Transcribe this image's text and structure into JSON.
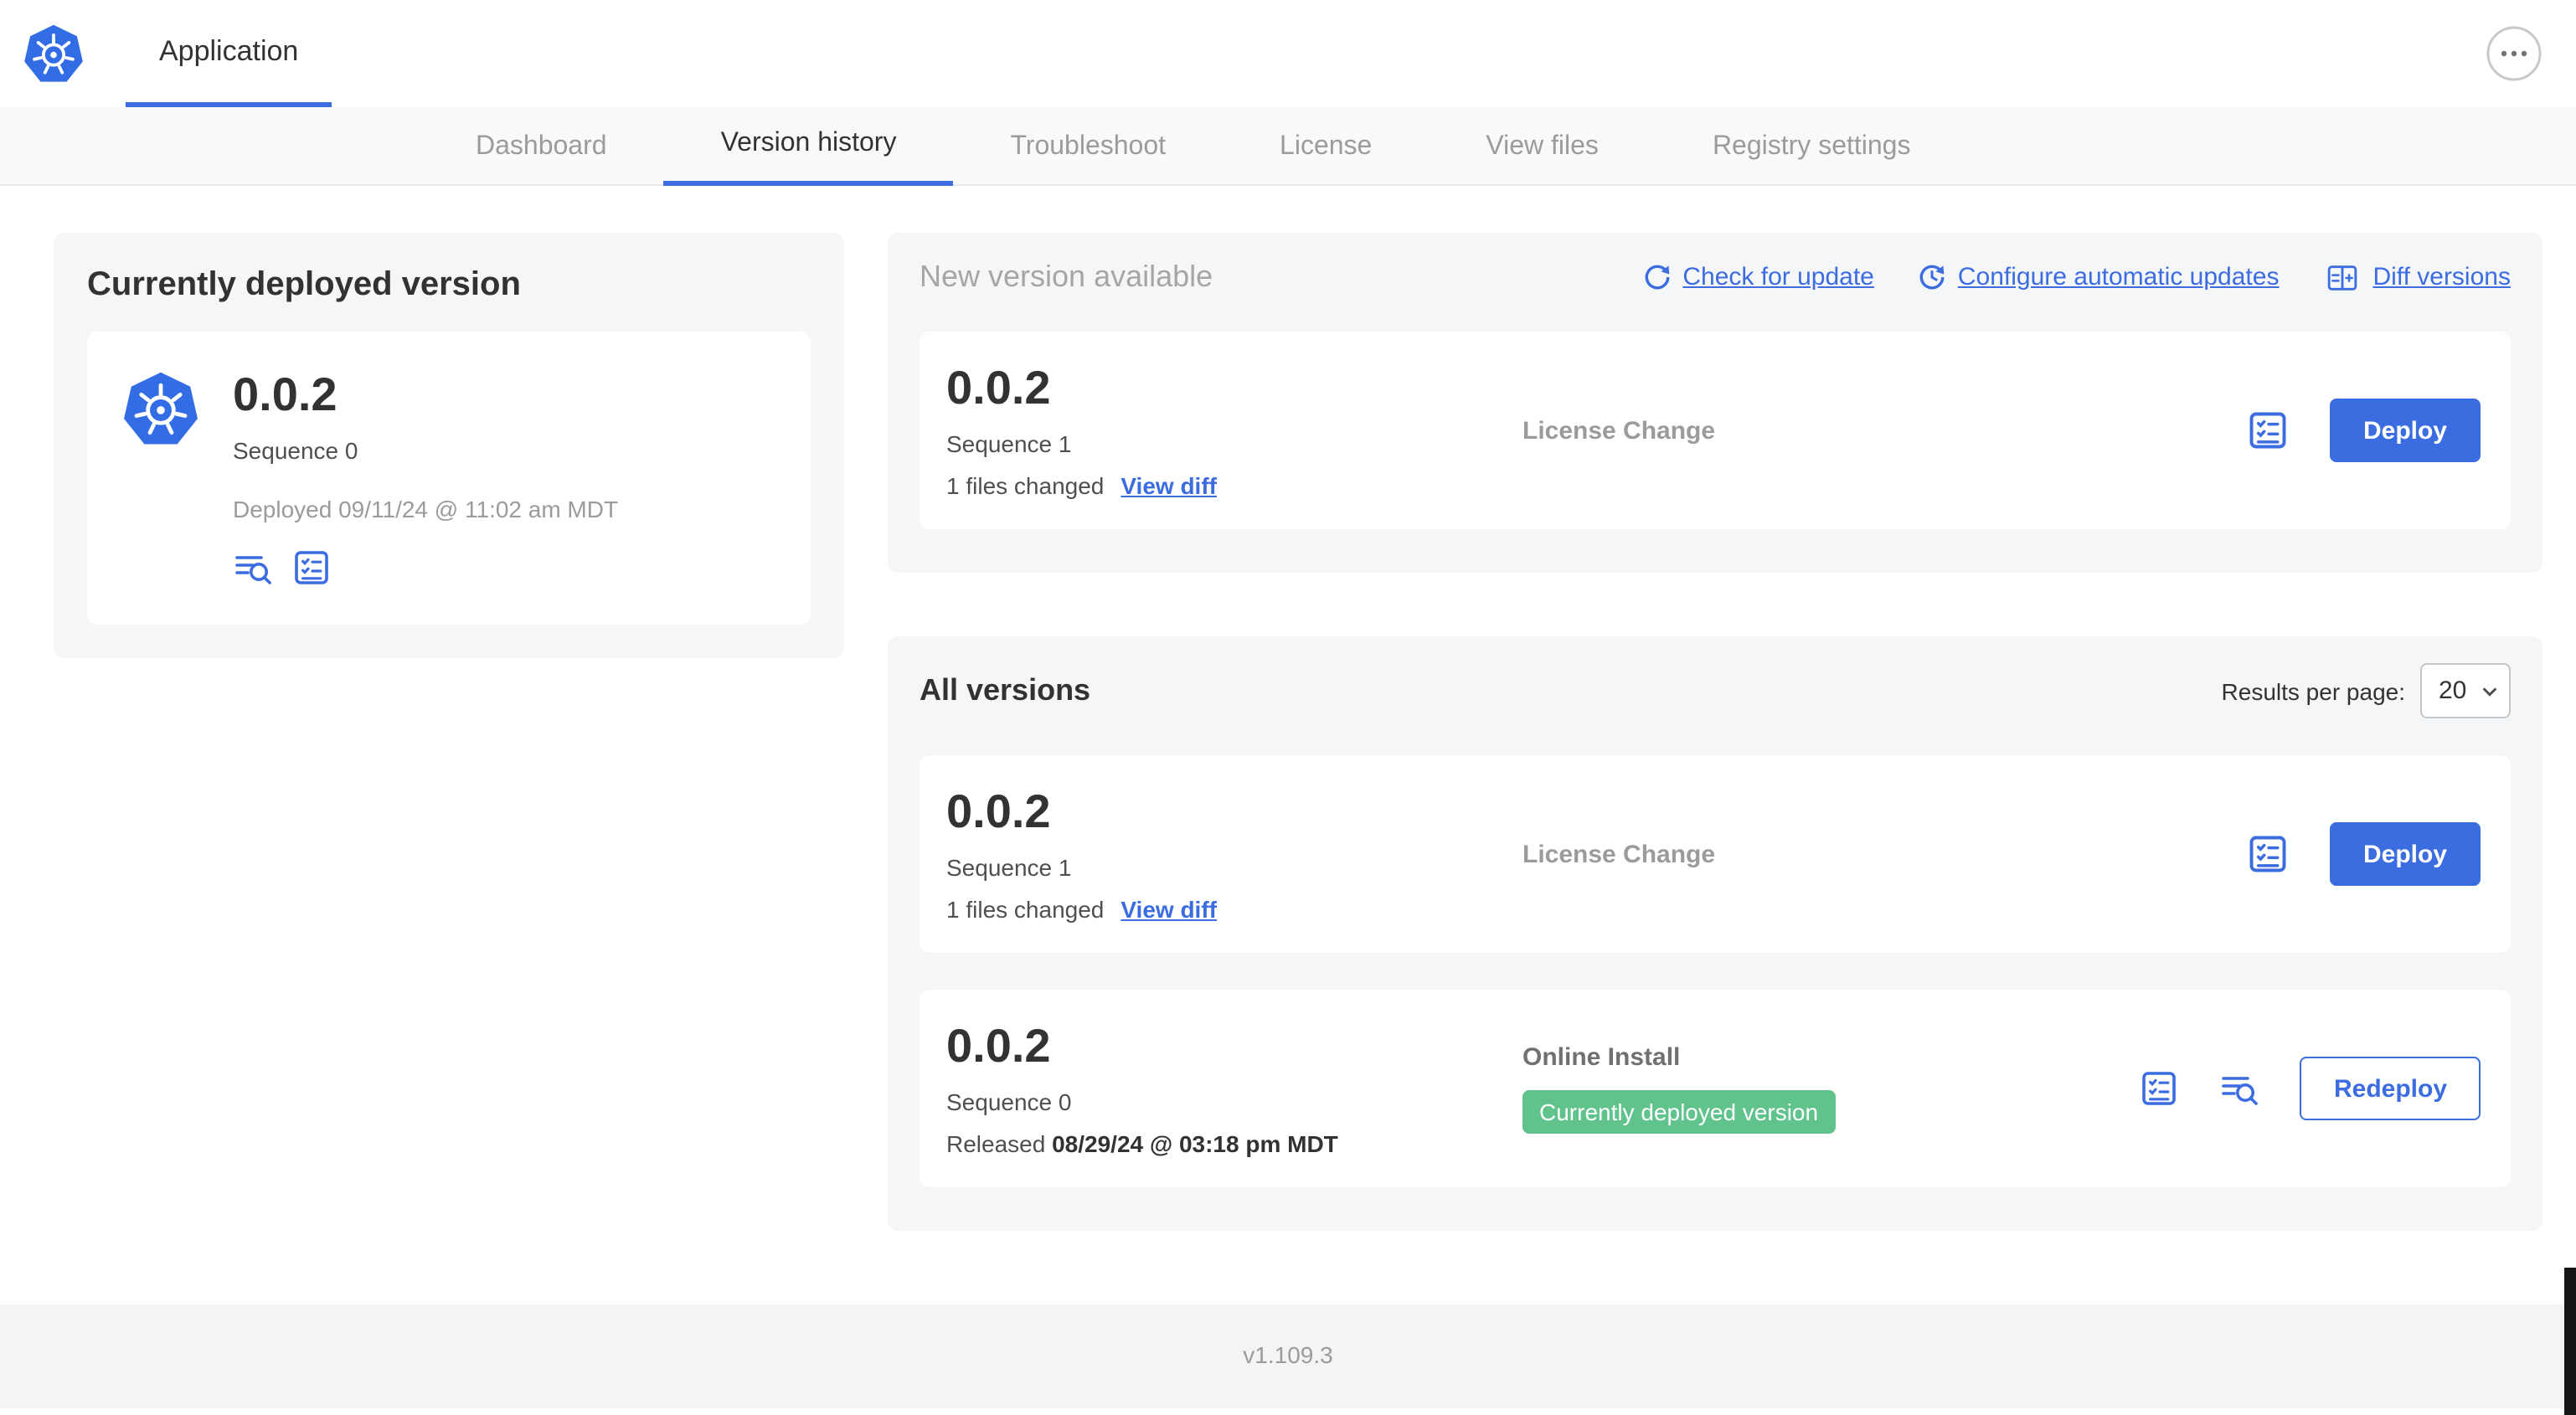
{
  "header": {
    "app_tab": "Application"
  },
  "nav": {
    "tabs": [
      "Dashboard",
      "Version history",
      "Troubleshoot",
      "License",
      "View files",
      "Registry settings"
    ]
  },
  "deployed_panel": {
    "title": "Currently deployed version",
    "version": "0.0.2",
    "sequence": "Sequence 0",
    "deployed_at": "Deployed 09/11/24 @ 11:02 am MDT"
  },
  "new_version_panel": {
    "title": "New version available",
    "check_for_update": "Check for update",
    "configure_updates": "Configure automatic updates",
    "diff_versions": "Diff versions",
    "card": {
      "version": "0.0.2",
      "sequence": "Sequence 1",
      "files_changed": "1 files changed",
      "view_diff": "View diff",
      "source": "License Change",
      "action": "Deploy"
    }
  },
  "all_versions_panel": {
    "title": "All versions",
    "results_per_page_label": "Results per page:",
    "results_per_page_value": "20",
    "rows": [
      {
        "version": "0.0.2",
        "sequence": "Sequence 1",
        "files_changed": "1 files changed",
        "view_diff": "View diff",
        "source": "License Change",
        "action": "Deploy"
      },
      {
        "version": "0.0.2",
        "sequence": "Sequence 0",
        "released_label": "Released",
        "released_date": "08/29/24 @ 03:18 pm MDT",
        "source": "Online Install",
        "badge": "Currently deployed version",
        "action": "Redeploy"
      }
    ]
  },
  "footer": {
    "app_version": "v1.109.3"
  },
  "colors": {
    "primary_blue": "#3b6ce0",
    "k8s_blue": "#326DE6",
    "badge_green": "#61c38c"
  }
}
